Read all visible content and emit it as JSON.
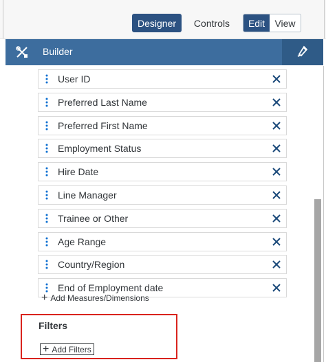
{
  "header": {
    "designer_label": "Designer",
    "controls_label": "Controls",
    "edit_label": "Edit",
    "view_label": "View"
  },
  "builder": {
    "title": "Builder",
    "tools_icon": "tools-icon",
    "format_icon": "paint-brush-icon"
  },
  "dimensions": [
    {
      "label": "User ID"
    },
    {
      "label": "Preferred Last Name"
    },
    {
      "label": "Preferred First Name"
    },
    {
      "label": "Employment Status"
    },
    {
      "label": "Hire Date"
    },
    {
      "label": "Line Manager"
    },
    {
      "label": "Trainee or Other"
    },
    {
      "label": "Age Range"
    },
    {
      "label": "Country/Region"
    },
    {
      "label": "End of Employment date"
    }
  ],
  "add_measures_label": "Add Measures/Dimensions",
  "filters": {
    "title": "Filters",
    "add_label": "Add Filters"
  },
  "colors": {
    "accent": "#2c5282",
    "builder_bar": "#3d6d9e",
    "highlight_box": "#d9231d"
  }
}
